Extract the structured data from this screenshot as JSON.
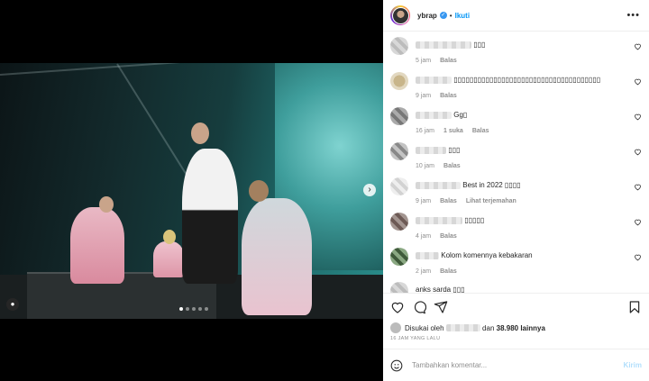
{
  "post": {
    "username": "ybrap",
    "follow_label": "Ikuti",
    "separator": "•",
    "more_icon": "more-horizontal-icon",
    "nav_next_icon": "chevron-right-icon",
    "tag_icon": "user-tag-icon",
    "carousel": {
      "count": 5,
      "active": 1
    }
  },
  "comments": [
    {
      "text": "▯▯▯",
      "time": "5 jam",
      "likes": "",
      "reply": "Balas",
      "translate": ""
    },
    {
      "text": "▯▯▯▯▯▯▯▯▯▯▯▯▯▯▯▯▯▯▯▯▯▯▯▯▯▯▯▯▯▯▯▯▯▯▯▯▯",
      "time": "9 jam",
      "likes": "",
      "reply": "Balas",
      "translate": ""
    },
    {
      "text": "Gg▯",
      "time": "16 jam",
      "likes": "1 suka",
      "reply": "Balas",
      "translate": ""
    },
    {
      "text": "▯▯▯",
      "time": "10 jam",
      "likes": "",
      "reply": "Balas",
      "translate": ""
    },
    {
      "text": "Best in 2022 ▯▯▯▯",
      "time": "9 jam",
      "likes": "",
      "reply": "Balas",
      "translate": "Lihat terjemahan"
    },
    {
      "text": "▯▯▯▯▯",
      "time": "4 jam",
      "likes": "",
      "reply": "Balas",
      "translate": ""
    },
    {
      "text": "Kolom komennya kebakaran",
      "time": "2 jam",
      "likes": "",
      "reply": "Balas",
      "translate": ""
    },
    {
      "text": "anks sarda ▯▯▯",
      "time": "",
      "likes": "",
      "reply": "",
      "translate": ""
    }
  ],
  "likes": {
    "prefix": "Disukai oleh",
    "middle": "dan",
    "count": "38.980 lainnya"
  },
  "timestamp": "16 JAM YANG LALU",
  "add_comment": {
    "placeholder": "Tambahkan komentar...",
    "post_label": "Kirim"
  },
  "colors": {
    "accent": "#0095f6",
    "verified": "#3897f0",
    "disabled_post": "#b2dffc"
  }
}
